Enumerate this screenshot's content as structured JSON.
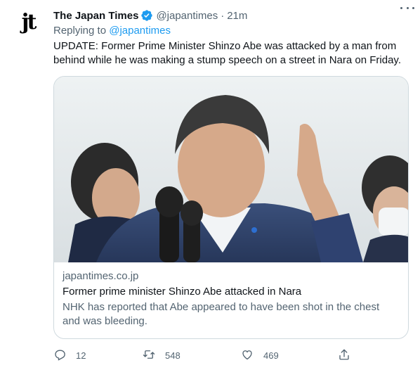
{
  "author": {
    "name": "The Japan Times",
    "handle": "@japantimes",
    "separator": "·",
    "time": "21m",
    "avatar_text": "jt",
    "verified_icon": "verified-badge-icon"
  },
  "reply": {
    "prefix": "Replying to",
    "to": "@japantimes"
  },
  "tweet_text": "UPDATE: Former Prime Minister Shinzo Abe was attacked by a man from behind while he was making a stump speech on a street in Nara on Friday.",
  "card": {
    "domain": "japantimes.co.jp",
    "title": "Former prime minister Shinzo Abe attacked in Nara",
    "description": "NHK has reported that Abe appeared to have been shot in the chest and was bleeding."
  },
  "actions": {
    "reply_count": "12",
    "retweet_count": "548",
    "like_count": "469"
  },
  "colors": {
    "accent": "#1d9bf0",
    "secondary_text": "#536471",
    "border": "#cfd9de"
  }
}
